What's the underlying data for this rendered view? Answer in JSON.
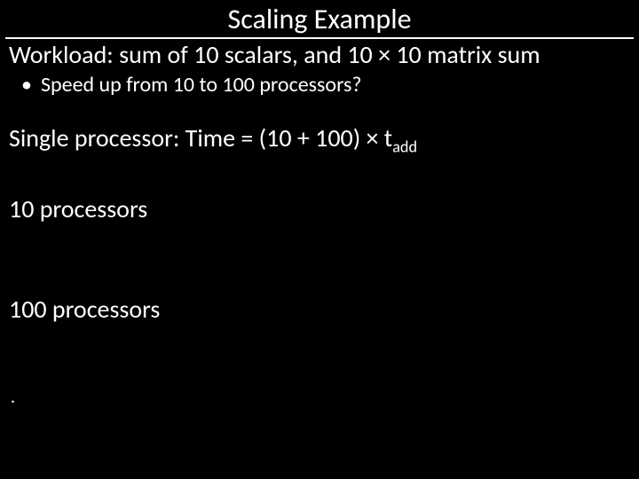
{
  "title": "Scaling Example",
  "body": {
    "workload": "Workload: sum of 10 scalars, and 10 × 10 matrix sum",
    "speedup_bullet": "Speed up from 10 to 100 processors?",
    "single_prefix": "Single processor: Time = (10 + 100) × t",
    "single_sub": "add",
    "ten_proc": "10 processors",
    "hundred_proc": "100 processors",
    "trailing_dot": "."
  }
}
